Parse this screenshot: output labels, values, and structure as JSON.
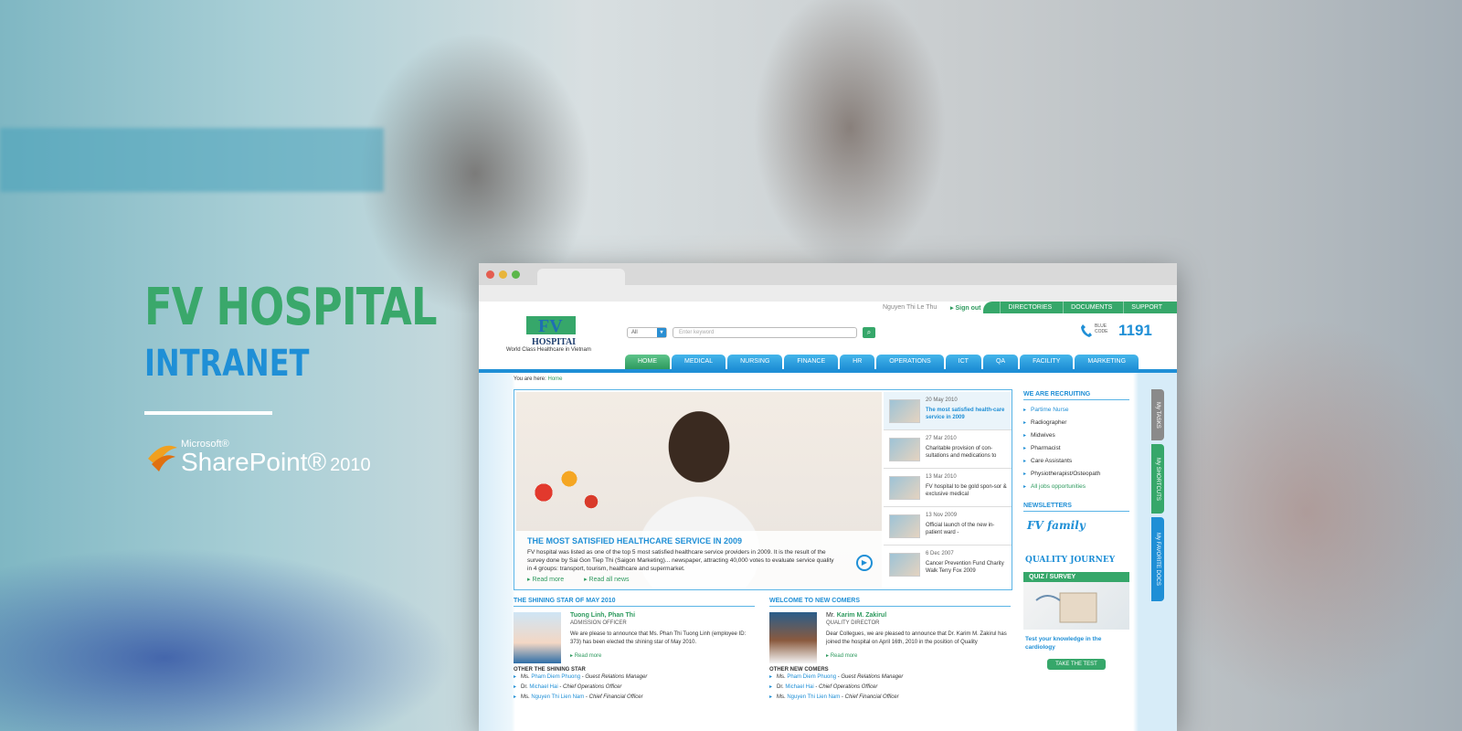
{
  "brand": {
    "title": "FV HOSPITAL",
    "subtitle": "INTRANET",
    "platform_small": "Microsoft®",
    "platform": "SharePoint®",
    "platform_year": "2010"
  },
  "colors": {
    "green": "#36a76a",
    "blue": "#1f8fd6",
    "light_blue": "#5ab4e6"
  },
  "site": {
    "user_name": "Nguyen Thi Le Thu",
    "signout": "Sign out",
    "top_links": [
      "DIRECTORIES",
      "DOCUMENTS",
      "SUPPORT"
    ],
    "logo_text": "FV",
    "logo_word": "HOSPITAL",
    "logo_tagline": "World Class Healthcare in Vietnam",
    "search": {
      "scope": "All",
      "placeholder": "Enter keyword",
      "button_icon": "search-icon"
    },
    "blue_code": {
      "label_1": "BLUE",
      "label_2": "CODE",
      "number": "1191"
    },
    "nav": [
      "HOME",
      "MEDICAL",
      "NURSING",
      "FINANCE",
      "HR",
      "OPERATIONS",
      "ICT",
      "QA",
      "FACILITY",
      "MARKETING"
    ],
    "breadcrumb": {
      "prefix": "You are here:",
      "current": "Home"
    },
    "featured": {
      "title": "THE MOST SATISFIED HEALTHCARE SERVICE IN 2009",
      "text": "FV hospital was listed as one of the top 5 most satisfied healthcare service providers in 2009. It is the result of the survey done by Sai Gon Tiep Thi (Saigon Marketing)... newspaper, attracting 40,000 votes to evaluate service quality in 4 groups: transport, tourism, healthcare and supermarket.",
      "read_more": "Read more",
      "read_all": "Read all news"
    },
    "news": [
      {
        "date": "20 May 2010",
        "text": "The most satisfied health-care service in 2009"
      },
      {
        "date": "27 Mar 2010",
        "text": "Charitable provision of con-sultations and medications to"
      },
      {
        "date": "13 Mar 2010",
        "text": "FV hospital to be gold spon-sor & exclusive medical"
      },
      {
        "date": "13 Nov 2009",
        "text": "Official launch of the new in-patient ward -"
      },
      {
        "date": "6 Dec 2007",
        "text": "Cancer Prevention Fund Charity Walk Terry Fox 2009"
      }
    ],
    "recruiting": {
      "title": "WE ARE RECRUITING",
      "items": [
        "Partime Nurse",
        "Radiographer",
        "Midwives",
        "Pharmacist",
        "Care Assistants",
        "Physiotherapist/Osteopath"
      ],
      "all_jobs": "All jobs opportunities"
    },
    "newsletters": {
      "title": "NEWSLETTERS",
      "fv_family": "FV family",
      "quality": "QUALITY JOURNEY"
    },
    "quiz": {
      "title": "QUIZ / SURVEY",
      "text": "Test your knowledge in the cardiology",
      "button": "TAKE THE TEST"
    },
    "shining": {
      "title": "THE SHINING STAR OF MAY 2010",
      "name": "Tuong Linh, Phan Thi",
      "role": "ADMISSION OFFICER",
      "text": "We are please to announce that Ms. Phan Thi Tuong Linh (employee ID: 373) has been elected the shining star of May 2010.",
      "read_more": "Read more",
      "other_title": "OTHER THE SHINING STAR",
      "others": [
        {
          "prefix": "Ms.",
          "name": "Pham Diem Phuong",
          "role": "Guest Relations Manager"
        },
        {
          "prefix": "Dr.",
          "name": "Michael Hai",
          "role": "Chief Operations Officer"
        },
        {
          "prefix": "Ms.",
          "name": "Nguyen Thi Lien Nam",
          "role": "Chief Financial Officer"
        }
      ]
    },
    "welcome": {
      "title": "WELCOME TO NEW COMERS",
      "prefix": "Mr.",
      "name": "Karim M. Zakirul",
      "role": "QUALITY DIRECTOR",
      "text": "Dear Collegues, we are pleased to announce that Dr. Karim M. Zakirul has joined the hospital on April 16th, 2010 in the position of Quality",
      "read_more": "Read more",
      "other_title": "OTHER NEW COMERS",
      "others": [
        {
          "prefix": "Ms.",
          "name": "Pham Diem Phuong",
          "role": "Guest Relations Manager"
        },
        {
          "prefix": "Dr.",
          "name": "Michael Hai",
          "role": "Chief Operations Officer"
        },
        {
          "prefix": "Ms.",
          "name": "Nguyen Thi Lien Nam",
          "role": "Chief Financial Officer"
        }
      ]
    },
    "side_tabs": [
      "My TASKS",
      "My SHORTCUTS",
      "My FAVORITE DOCS"
    ]
  }
}
